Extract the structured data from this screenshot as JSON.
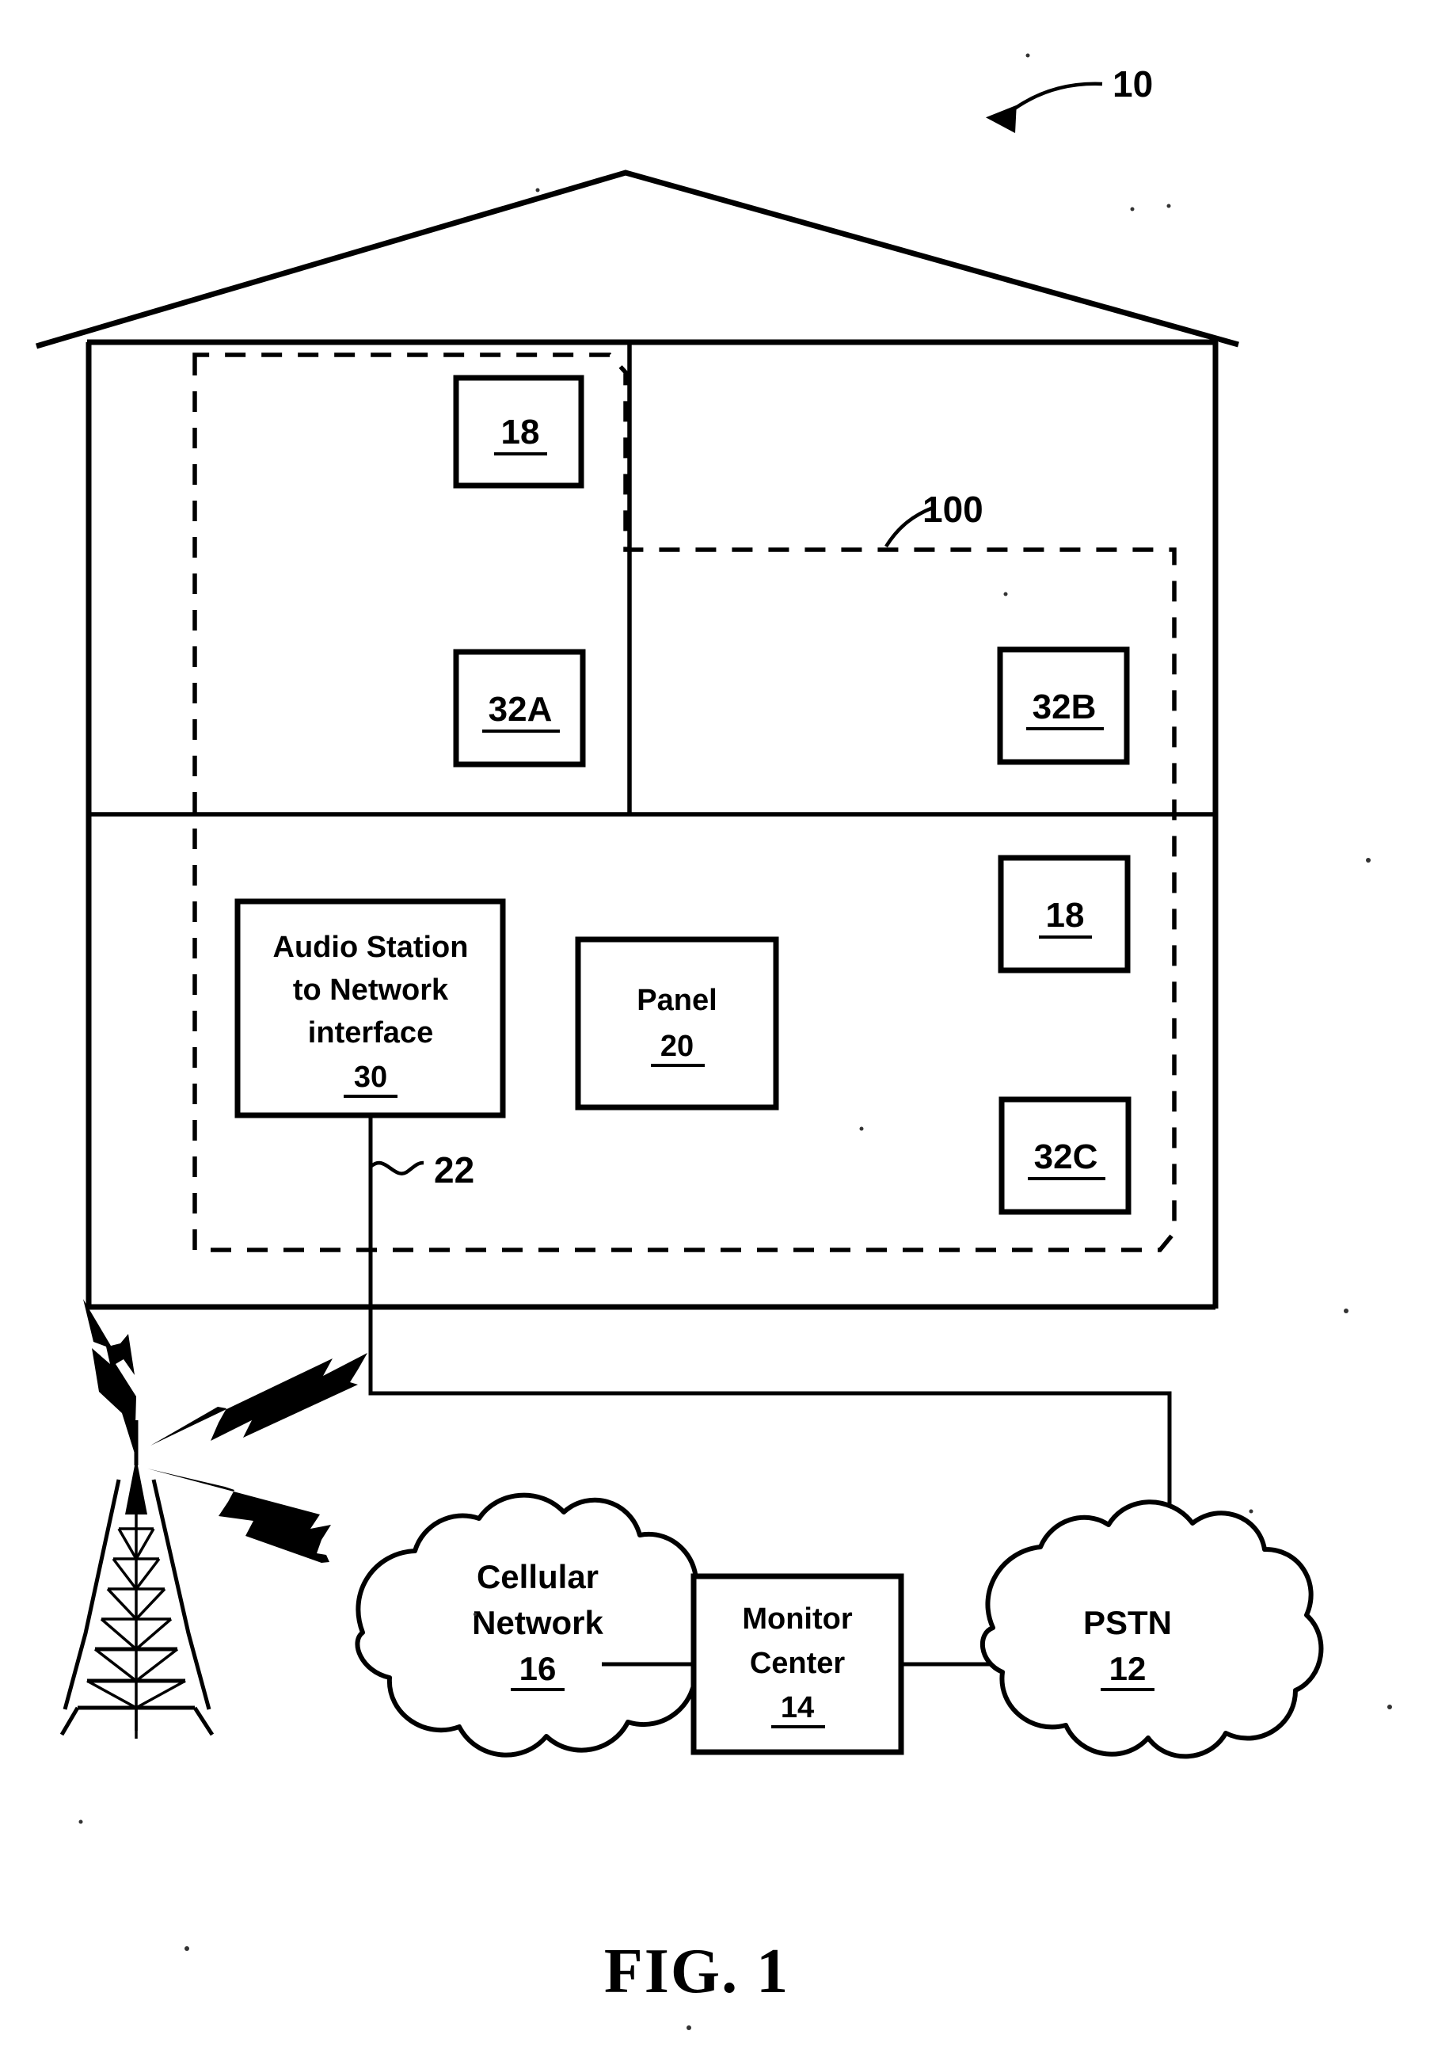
{
  "figure": {
    "caption": "FIG. 1",
    "system_ref": "10",
    "network_region_ref": "100",
    "wire_ref": "22"
  },
  "house": {
    "upper_left_room": {
      "device_ref": "18",
      "sensor_ref": "32A"
    },
    "upper_right_room": {
      "sensor_ref": "32B"
    },
    "lower_room": {
      "interface_line1": "Audio Station",
      "interface_line2": "to Network",
      "interface_line3": "interface",
      "interface_ref": "30",
      "panel_label": "Panel",
      "panel_ref": "20",
      "device_ref": "18",
      "sensor_ref": "32C"
    }
  },
  "network": {
    "cellular": {
      "line1": "Cellular",
      "line2": "Network",
      "ref": "16"
    },
    "monitor": {
      "line1": "Monitor",
      "line2": "Center",
      "ref": "14"
    },
    "pstn": {
      "line1": "PSTN",
      "ref": "12"
    },
    "tower_name": "cell-tower-icon",
    "rf_signal_name": "lightning-bolt-icon"
  },
  "colors": {
    "ink": "#000000",
    "paper": "#ffffff"
  }
}
